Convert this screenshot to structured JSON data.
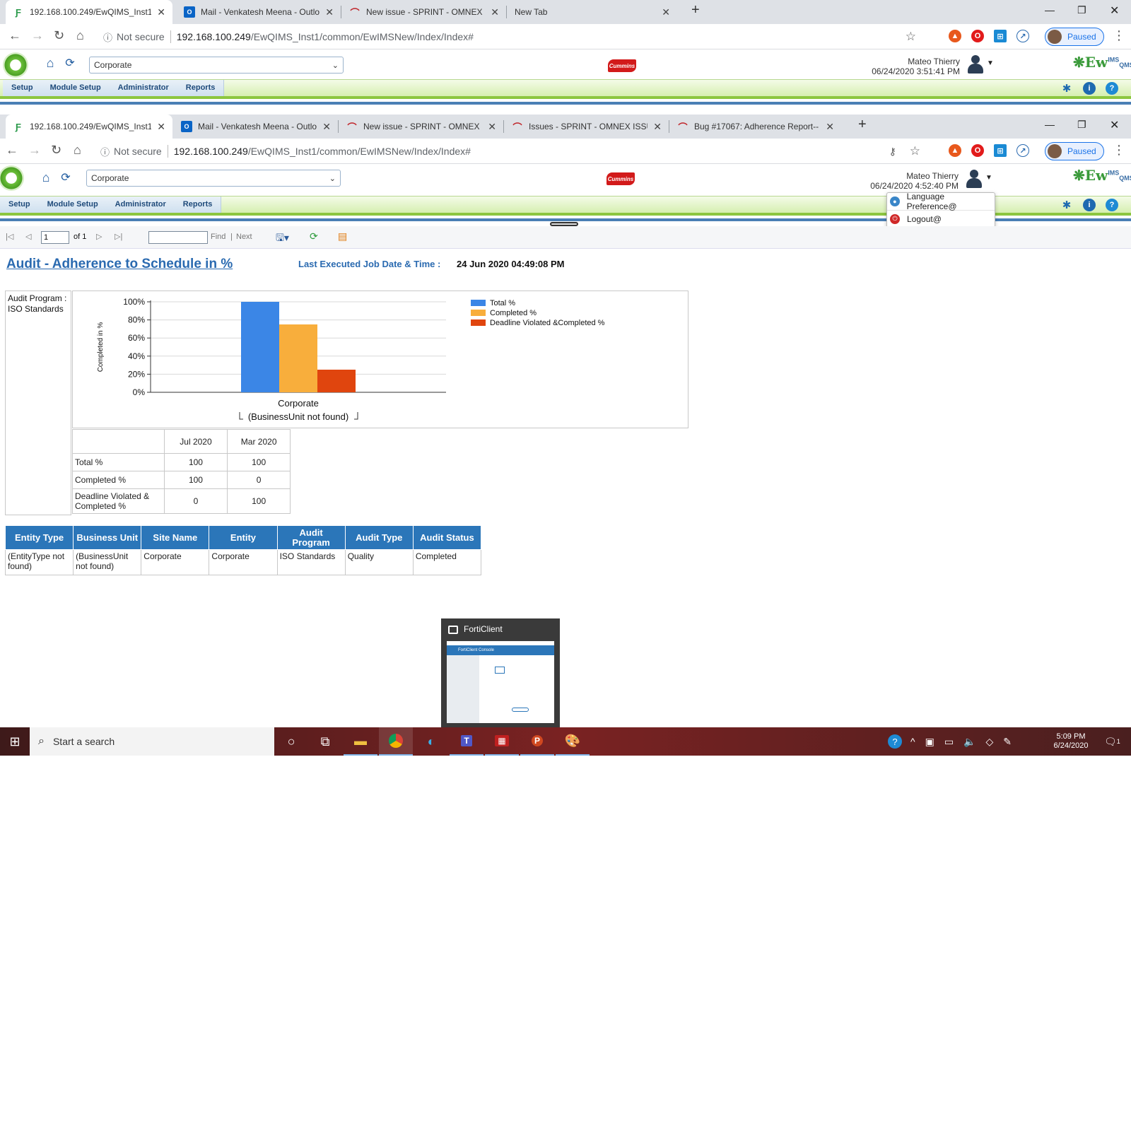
{
  "window1": {
    "tabs": [
      {
        "title": "192.168.100.249/EwQIMS_Inst1/c",
        "icon": "ewqims-favicon"
      },
      {
        "title": "Mail - Venkatesh Meena - Outloc",
        "icon": "outlook-icon"
      },
      {
        "title": "New issue - SPRINT - OMNEX ISS",
        "icon": "redmine-icon"
      },
      {
        "title": "New Tab",
        "icon": ""
      }
    ],
    "url_host": "192.168.100.249",
    "url_path": "/EwQIMS_Inst1/common/EwIMSNew/Index/Index#",
    "not_secure": "Not secure",
    "paused": "Paused"
  },
  "window2": {
    "tabs": [
      {
        "title": "192.168.100.249/EwQIMS_Inst1/c",
        "icon": "ewqims-favicon"
      },
      {
        "title": "Mail - Venkatesh Meena - Outloc",
        "icon": "outlook-icon"
      },
      {
        "title": "New issue - SPRINT - OMNEX ISS",
        "icon": "redmine-icon"
      },
      {
        "title": "Issues - SPRINT - OMNEX ISSUE",
        "icon": "redmine-icon"
      },
      {
        "title": "Bug #17067: Adherence Report--",
        "icon": "redmine-icon"
      }
    ],
    "url_host": "192.168.100.249",
    "url_path": "/EwQIMS_Inst1/common/EwIMSNew/Index/Index#",
    "not_secure": "Not secure",
    "paused": "Paused"
  },
  "app1": {
    "business_unit": "Corporate",
    "user_name": "Mateo Thierry",
    "datetime": "06/24/2020 3:51:41 PM",
    "menu": [
      "Setup",
      "Module Setup",
      "Administrator",
      "Reports"
    ],
    "logo_brand": "Ew",
    "logo_sup": "IMS",
    "logo_sub": "QMS"
  },
  "app2": {
    "business_unit": "Corporate",
    "user_name": "Mateo Thierry",
    "datetime": "06/24/2020 4:52:40 PM",
    "menu": [
      "Setup",
      "Module Setup",
      "Administrator",
      "Reports"
    ],
    "user_menu": [
      "Language Preference@",
      "Logout@"
    ],
    "logo_brand": "Ew",
    "logo_sup": "IMS",
    "logo_sub": "QMS"
  },
  "report_toolbar": {
    "page": "1",
    "of": "of 1",
    "find": "Find",
    "sep": "|",
    "next": "Next"
  },
  "report": {
    "title": "Audit - Adherence to Schedule in % ",
    "last_exec_label": "Last Executed Job Date & Time :",
    "last_exec_value": "24 Jun 2020 04:49:08 PM",
    "program_label": "Audit Program : ISO Standards"
  },
  "chart_data": {
    "type": "bar",
    "categories": [
      "Corporate"
    ],
    "category_sublabel": "(BusinessUnit not found)",
    "series": [
      {
        "name": "Total %",
        "values": [
          100
        ],
        "color": "#3b86e6"
      },
      {
        "name": "Completed %",
        "values": [
          75
        ],
        "color": "#f8ae3c"
      },
      {
        "name": "Deadline Violated &Completed %",
        "values": [
          25
        ],
        "color": "#e0450e"
      }
    ],
    "ylabel": "Completed in %",
    "ylim": [
      0,
      100
    ],
    "yticks": [
      "0%",
      "20%",
      "40%",
      "60%",
      "80%",
      "100%"
    ],
    "grid": true,
    "legend": "right"
  },
  "summary_table": {
    "headers": [
      "",
      "Jul 2020",
      "Mar 2020"
    ],
    "rows": [
      [
        "Total %",
        "100",
        "100"
      ],
      [
        "Completed %",
        "100",
        "0"
      ],
      [
        "Deadline Violated & Completed %",
        "0",
        "100"
      ]
    ]
  },
  "detail_table": {
    "headers": [
      "Entity Type",
      "Business Unit",
      "Site Name",
      "Entity",
      "Audit Program",
      "Audit Type",
      "Audit Status"
    ],
    "rows": [
      [
        "(EntityType not found)",
        "(BusinessUnit not found)",
        "Corporate",
        "Corporate",
        "ISO Standards",
        "Quality",
        "Completed"
      ]
    ]
  },
  "forticlient": {
    "title": "FortiClient",
    "preview_header": "FortiClient Console"
  },
  "taskbar": {
    "search_placeholder": "Start a search",
    "time": "5:09 PM",
    "date": "6/24/2020",
    "notif_count": "1"
  }
}
